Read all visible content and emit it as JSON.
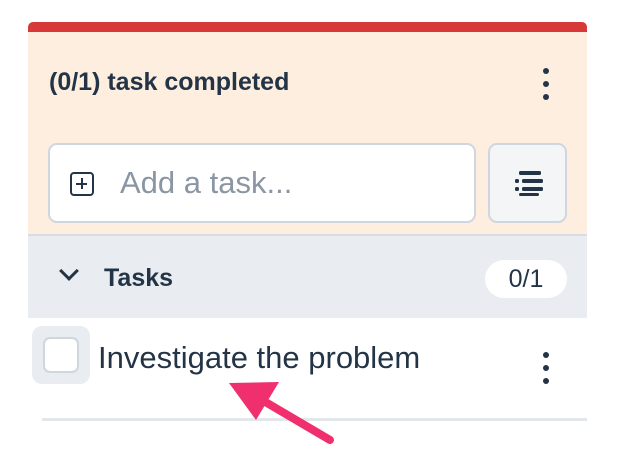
{
  "header": {
    "title": "(0/1) task completed",
    "menu_icon": "more-vertical-icon"
  },
  "add_task": {
    "placeholder": "Add a task...",
    "icon": "plus-square-icon",
    "list_button_icon": "list-options-icon"
  },
  "section": {
    "title": "Tasks",
    "count": "0/1",
    "toggle_icon": "chevron-down-icon"
  },
  "tasks": [
    {
      "label": "Investigate the problem",
      "completed": false
    }
  ],
  "colors": {
    "accent": "#d73838",
    "header_bg": "#fdeedf",
    "section_bg": "#e9edf2",
    "text": "#243447",
    "annotation_arrow": "#f0306e"
  }
}
